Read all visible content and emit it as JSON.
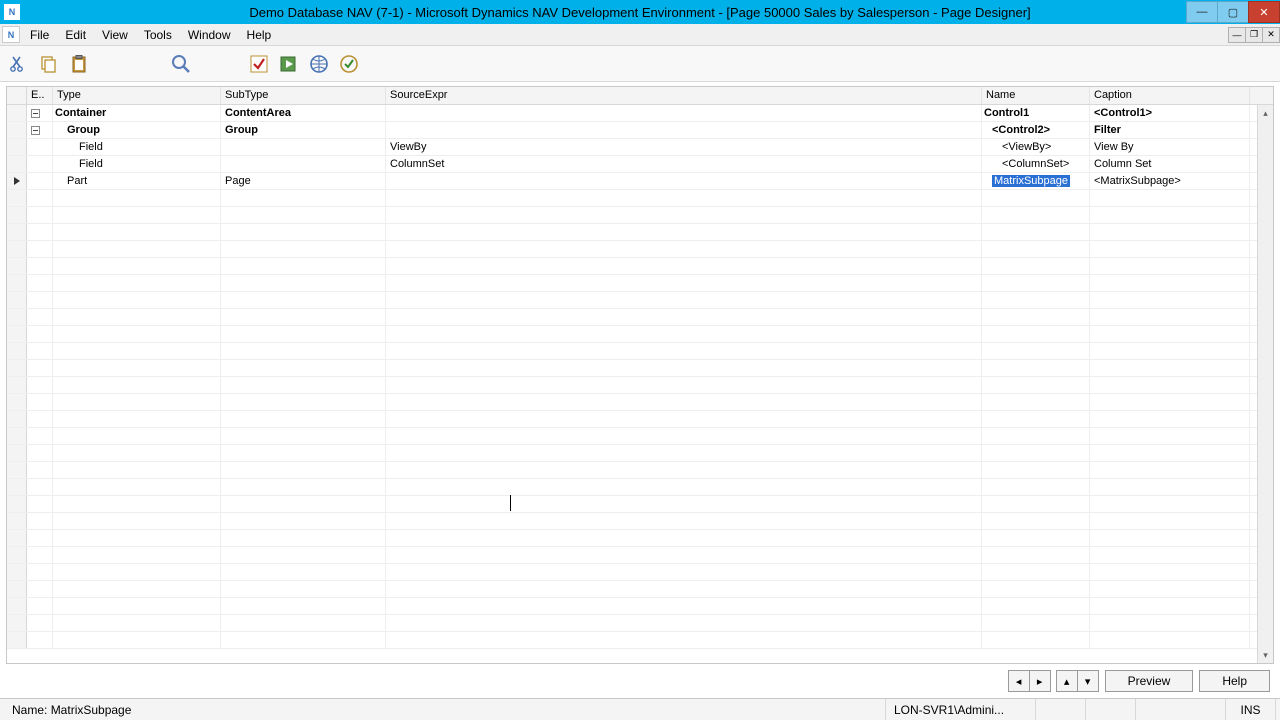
{
  "title": "Demo Database NAV (7-1) - Microsoft Dynamics NAV Development Environment - [Page 50000 Sales by Salesperson - Page Designer]",
  "menu": {
    "file": "File",
    "edit": "Edit",
    "view": "View",
    "tools": "Tools",
    "window": "Window",
    "help": "Help"
  },
  "columns": {
    "expand": "E..",
    "type": "Type",
    "subtype": "SubType",
    "sourceexpr": "SourceExpr",
    "name": "Name",
    "caption": "Caption"
  },
  "rows": [
    {
      "bold": true,
      "indent": 0,
      "type": "Container",
      "subtype": "ContentArea",
      "sourceexpr": "",
      "name": "Control1",
      "caption": "<Control1>",
      "tree": true,
      "selected": false
    },
    {
      "bold": true,
      "indent": 1,
      "type": "Group",
      "subtype": "Group",
      "sourceexpr": "",
      "name": "<Control2>",
      "caption": "Filter",
      "tree": true,
      "selected": false
    },
    {
      "bold": false,
      "indent": 2,
      "type": "Field",
      "subtype": "",
      "sourceexpr": "ViewBy",
      "name": "<ViewBy>",
      "caption": "View By",
      "tree": false,
      "selected": false
    },
    {
      "bold": false,
      "indent": 2,
      "type": "Field",
      "subtype": "",
      "sourceexpr": "ColumnSet",
      "name": "<ColumnSet>",
      "caption": "Column Set",
      "tree": false,
      "selected": false
    },
    {
      "bold": false,
      "indent": 1,
      "type": "Part",
      "subtype": "Page",
      "sourceexpr": "",
      "name": "MatrixSubpage",
      "caption": "<MatrixSubpage>",
      "tree": false,
      "selected": true,
      "current": true
    }
  ],
  "empty_row_count": 27,
  "footer": {
    "preview": "Preview",
    "help": "Help"
  },
  "status": {
    "name_label": "Name:",
    "name_value": "MatrixSubpage",
    "server": "LON-SVR1\\Admini...",
    "ins": "INS"
  }
}
